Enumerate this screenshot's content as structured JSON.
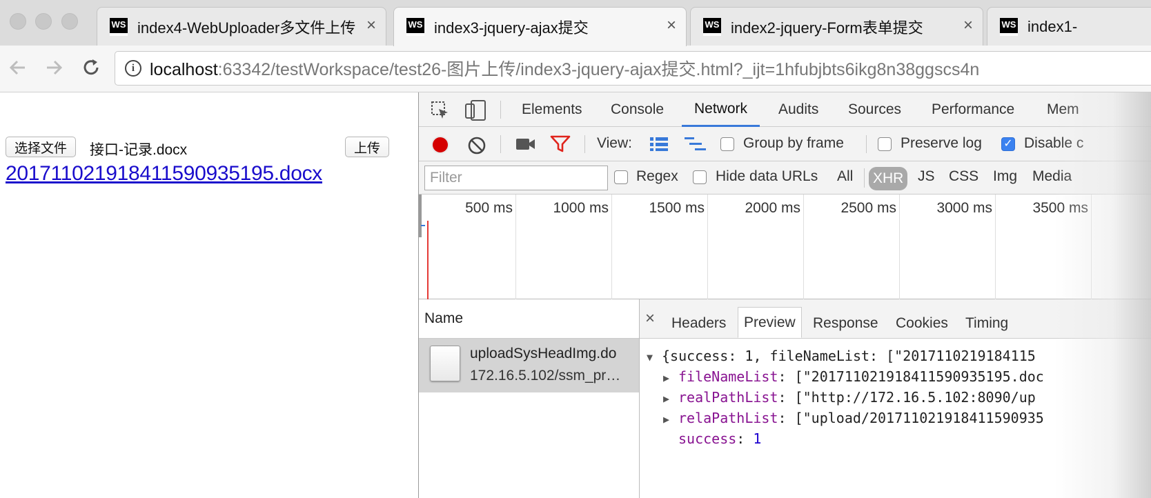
{
  "browser": {
    "tabs": [
      {
        "title": "index4-WebUploader多文件上传",
        "close": "×"
      },
      {
        "title": "index3-jquery-ajax提交",
        "close": "×"
      },
      {
        "title": "index2-jquery-Form表单提交",
        "close": "×"
      },
      {
        "title": "index1-",
        "close": ""
      }
    ],
    "tab_icon_text": "WS",
    "address": {
      "host": "localhost",
      "rest": ":63342/testWorkspace/test26-图片上传/index3-jquery-ajax提交.html?_ijt=1hfubjbts6ikg8n38ggscs4n"
    }
  },
  "page": {
    "choose_file_button": "选择文件",
    "selected_file": "接口-记录.docx",
    "upload_button": "上传",
    "result_link": "2017110219184115909351​95.docx"
  },
  "devtools": {
    "tabs": [
      "Elements",
      "Console",
      "Network",
      "Audits",
      "Sources",
      "Performance",
      "Mem"
    ],
    "active_tab": "Network",
    "controls": {
      "view_label": "View:",
      "group_by_frame": "Group by frame",
      "preserve_log": "Preserve log",
      "disable_cache": "Disable c"
    },
    "filter": {
      "placeholder": "Filter",
      "regex": "Regex",
      "hide_data_urls": "Hide data URLs",
      "types": [
        "All",
        "XHR",
        "JS",
        "CSS",
        "Img",
        "Media"
      ],
      "active_type": "XHR"
    },
    "timeline_ticks": [
      "500 ms",
      "1000 ms",
      "1500 ms",
      "2000 ms",
      "2500 ms",
      "3000 ms",
      "3500 ms"
    ],
    "name_header": "Name",
    "request": {
      "name": "uploadSysHeadImg.do",
      "url": "172.16.5.102/ssm_pr…"
    },
    "detail_tabs": [
      "Headers",
      "Preview",
      "Response",
      "Cookies",
      "Timing"
    ],
    "active_detail_tab": "Preview",
    "close_symbol": "×",
    "preview": {
      "summary": "{success: 1, fileNameList: [\"2017110219184115",
      "lines": [
        {
          "key": "fileNameList",
          "value": "[\"20171102191841159093519​5.doc"
        },
        {
          "key": "realPathList",
          "value": "[\"http://172.16.5.102:8090/up"
        },
        {
          "key": "relaPathList",
          "value": "[\"upload/201711021918411590935"
        },
        {
          "key": "success",
          "value": "1"
        }
      ]
    }
  },
  "colors": {
    "record": "#d50000",
    "filter_icon": "#e0241c",
    "network_underline": "#3879d9",
    "json_key": "#881391",
    "json_number": "#1c00cf",
    "link": "#1a0dcc"
  }
}
